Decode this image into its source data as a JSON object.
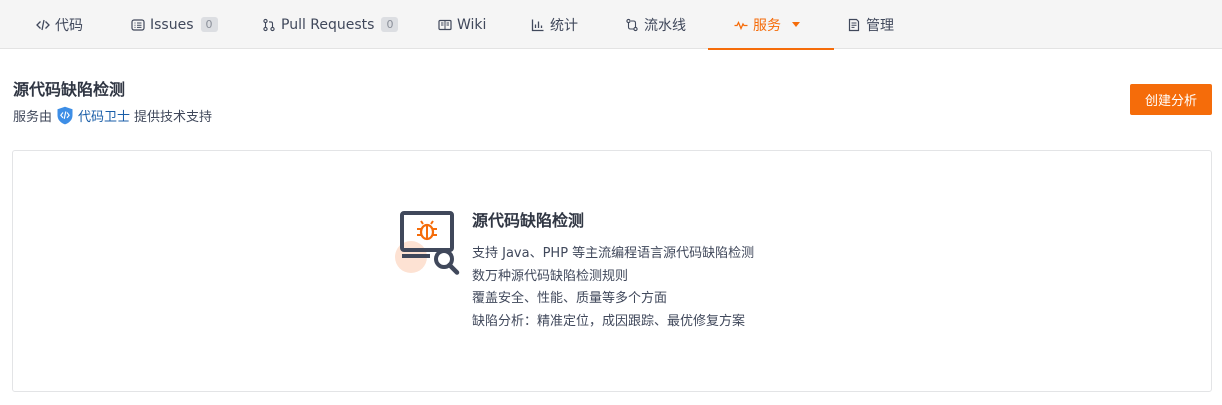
{
  "tabs": [
    {
      "label": "代码",
      "icon": "code-icon"
    },
    {
      "label": "Issues",
      "icon": "issues-icon",
      "count": "0"
    },
    {
      "label": "Pull Requests",
      "icon": "pull-request-icon",
      "count": "0"
    },
    {
      "label": "Wiki",
      "icon": "wiki-icon"
    },
    {
      "label": "统计",
      "icon": "stats-icon"
    },
    {
      "label": "流水线",
      "icon": "pipeline-icon"
    },
    {
      "label": "服务",
      "icon": "pulse-icon",
      "active": true,
      "dropdown": true
    },
    {
      "label": "管理",
      "icon": "manage-icon"
    }
  ],
  "page": {
    "title": "源代码缺陷检测",
    "support_prefix": "服务由",
    "support_link": "代码卫士",
    "support_suffix": "提供技术支持",
    "create_button": "创建分析"
  },
  "card": {
    "title": "源代码缺陷检测",
    "features": [
      "支持 Java、PHP 等主流编程语言源代码缺陷检测",
      "数万种源代码缺陷检测规则",
      "覆盖安全、性能、质量等多个方面",
      "缺陷分析：精准定位，成因跟踪、最优修复方案"
    ]
  },
  "colors": {
    "accent": "#f56c0a",
    "link": "#1a5ea8",
    "shield": "#3d8ee6"
  }
}
